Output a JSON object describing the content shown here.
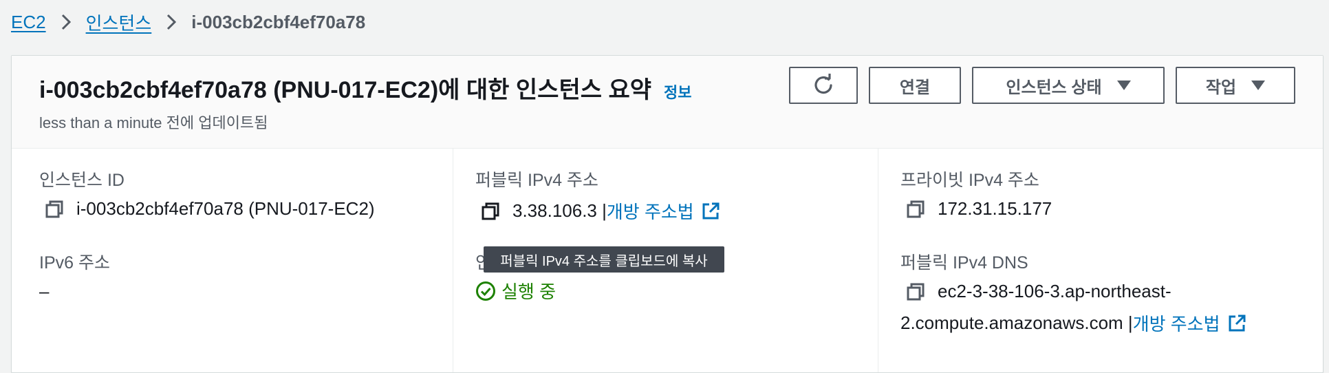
{
  "breadcrumb": {
    "items": [
      "EC2",
      "인스턴스"
    ],
    "current": "i-003cb2cbf4ef70a78"
  },
  "header": {
    "title": "i-003cb2cbf4ef70a78 (PNU-017-EC2)에 대한 인스턴스 요약",
    "info_label": "정보",
    "updated": "less than a minute 전에 업데이트됨"
  },
  "actions": {
    "refresh_icon": "refresh-icon",
    "connect": "연결",
    "instance_state": "인스턴스 상태",
    "actions": "작업"
  },
  "details": {
    "instance_id": {
      "label": "인스턴스 ID",
      "value": "i-003cb2cbf4ef70a78 (PNU-017-EC2)"
    },
    "public_ipv4": {
      "label": "퍼블릭 IPv4 주소",
      "value": "3.38.106.3 |",
      "link": "개방 주소법"
    },
    "private_ipv4": {
      "label": "프라이빗 IPv4 주소",
      "value": "172.31.15.177"
    },
    "ipv6": {
      "label": "IPv6 주소",
      "value": "–"
    },
    "instance_state": {
      "label": "인스",
      "value": "실행 중"
    },
    "public_dns": {
      "label": "퍼블릭 IPv4 DNS",
      "value_line1": "ec2-3-38-106-3.ap-northeast-",
      "value_line2": "2.compute.amazonaws.com |",
      "link": "개방 주소법"
    }
  },
  "tooltip": {
    "text": "퍼블릭 IPv4 주소를 클립보드에 복사"
  },
  "colors": {
    "link": "#0073bb",
    "running": "#1d8102",
    "tooltip_bg": "#414750"
  }
}
